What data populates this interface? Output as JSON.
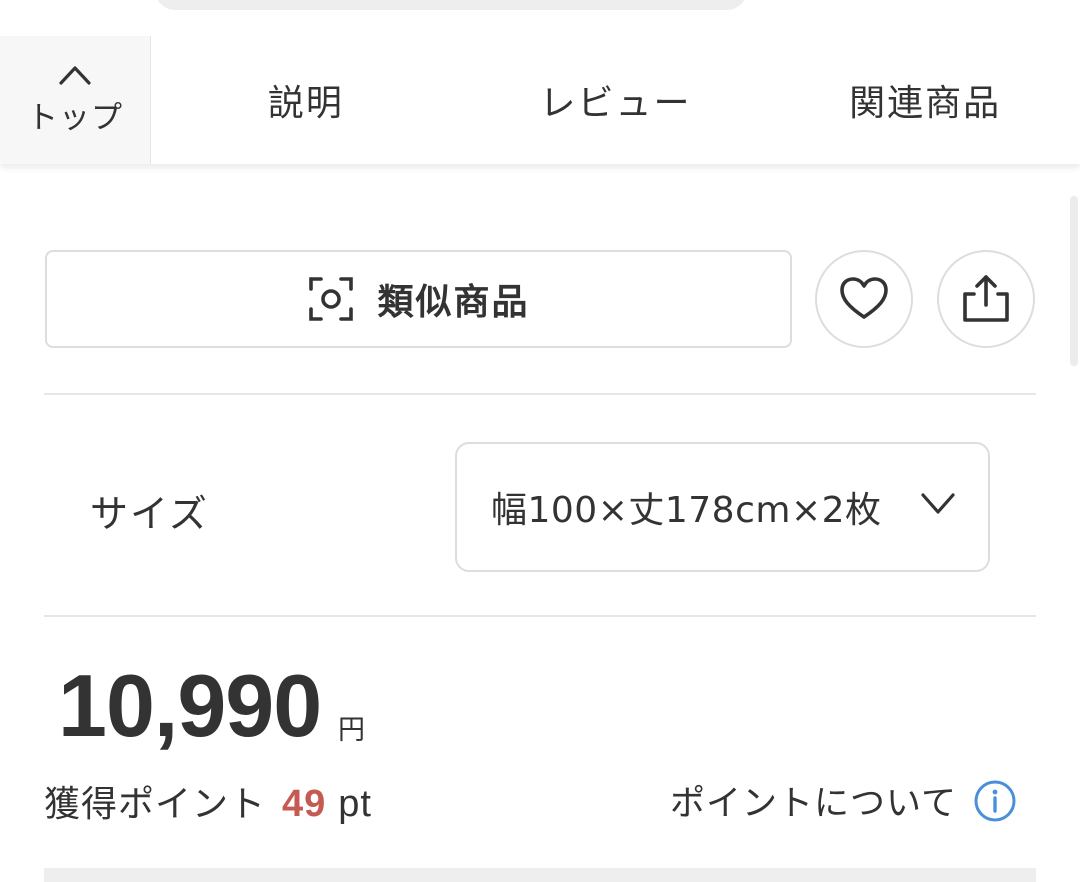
{
  "tabbar": {
    "top_label": "トップ",
    "tabs": [
      {
        "label": "説明"
      },
      {
        "label": "レビュー"
      },
      {
        "label": "関連商品"
      }
    ]
  },
  "actions": {
    "similar_label": "類似商品",
    "icons": [
      "camera-scan-icon",
      "heart-icon",
      "share-icon"
    ]
  },
  "size": {
    "label": "サイズ",
    "selected": "幅100×丈178cm×2枚"
  },
  "price": {
    "amount": "10,990",
    "unit": "円"
  },
  "points": {
    "label": "獲得ポイント",
    "value": "49",
    "unit": "pt",
    "link_text": "ポイントについて"
  },
  "colors": {
    "text": "#333333",
    "points_accent": "#c55a52",
    "info_icon": "#4a90d9",
    "border": "#dddddd"
  }
}
